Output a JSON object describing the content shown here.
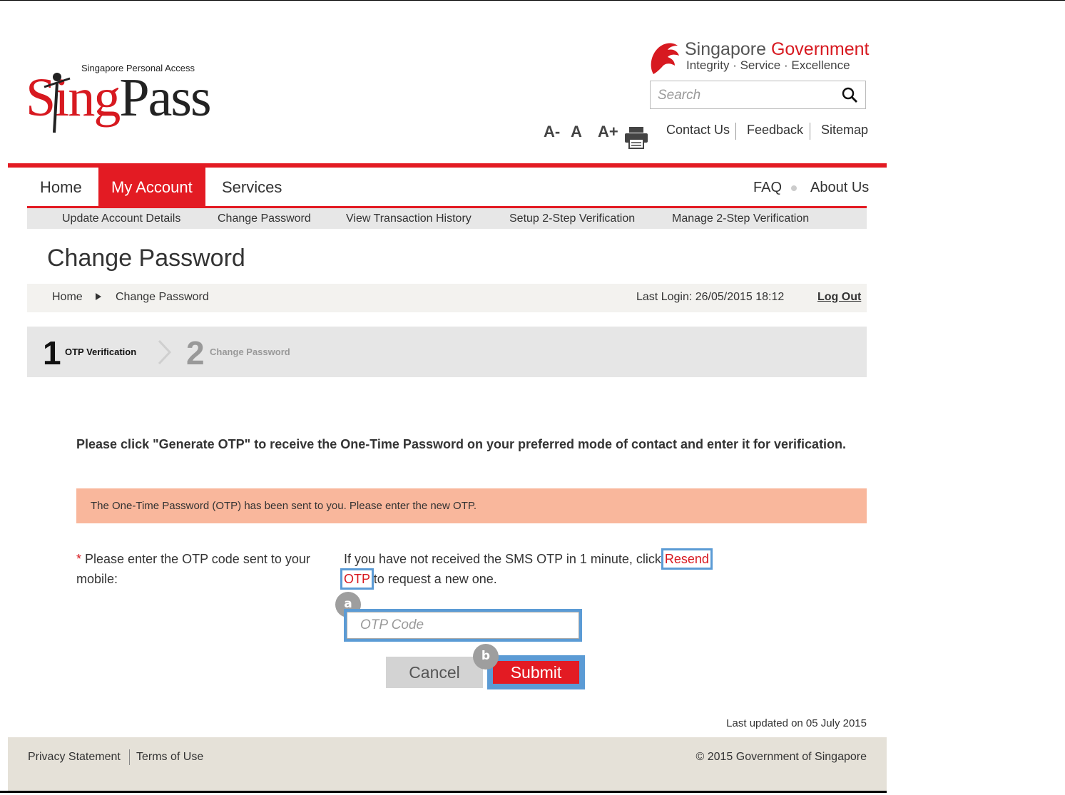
{
  "logo": {
    "tagline": "Singapore Personal Access",
    "brand_s": "S",
    "brand_ing": "ing",
    "brand_pass": "Pass"
  },
  "gov": {
    "title_part1": "Singapore ",
    "title_part2": "Government",
    "tagline": "Integrity · Service · Excellence"
  },
  "search": {
    "placeholder": "Search"
  },
  "font_controls": {
    "decrease": "A-",
    "normal": "A",
    "increase": "A+"
  },
  "top_links": {
    "contact": "Contact Us",
    "feedback": "Feedback",
    "sitemap": "Sitemap"
  },
  "nav": {
    "home": "Home",
    "my_account": "My Account",
    "services": "Services",
    "faq": "FAQ",
    "about": "About Us"
  },
  "subnav": {
    "update": "Update Account Details",
    "change_password": "Change Password",
    "history": "View Transaction History",
    "setup_2step": "Setup 2-Step Verification",
    "manage_2step": "Manage 2-Step Verification"
  },
  "page_title": "Change Password",
  "breadcrumb": {
    "home": "Home",
    "current": "Change Password",
    "last_login": "Last Login: 26/05/2015 18:12",
    "logout": "Log Out"
  },
  "steps": [
    {
      "num": "1",
      "label": "OTP Verification"
    },
    {
      "num": "2",
      "label": "Change Password"
    }
  ],
  "instructions": "Please click \"Generate OTP\" to receive the One-Time Password on your preferred mode of contact and enter it for verification.",
  "alert": "The One-Time Password (OTP) has been sent to you. Please enter the new OTP.",
  "form": {
    "required_mark": "*",
    "label": " Please enter the OTP code sent to your mobile:",
    "sms_text_before": "If you have not received the SMS OTP in 1 minute, click ",
    "resend": "Resend OTP",
    "sms_text_after": " to request a new one.",
    "otp_placeholder": "OTP Code",
    "cancel": "Cancel",
    "submit": "Submit"
  },
  "badges": {
    "a": "a",
    "b": "b"
  },
  "last_updated": "Last updated on 05 July 2015",
  "footer": {
    "privacy": "Privacy Statement",
    "terms": "Terms of Use",
    "copyright": "© 2015 Government of Singapore"
  },
  "colors": {
    "brand_red": "#e31b23",
    "highlight_blue": "#5b9bd5",
    "alert_bg": "#f9b79c"
  }
}
